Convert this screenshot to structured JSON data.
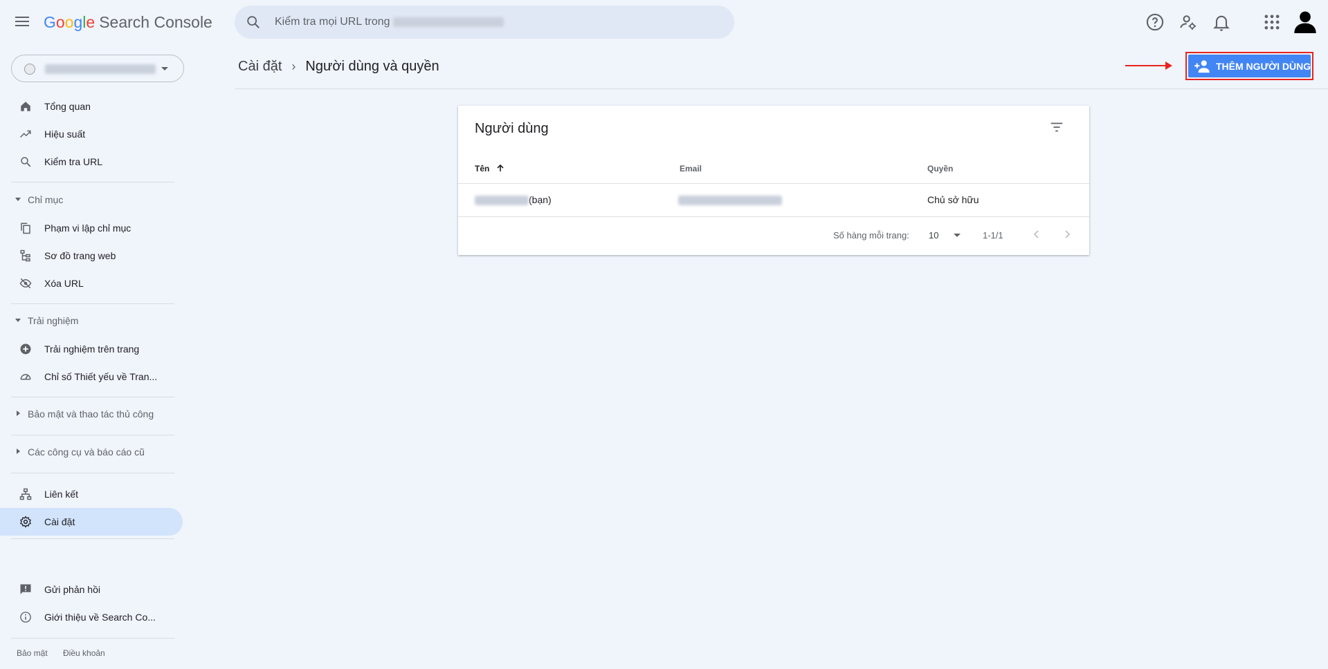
{
  "app": {
    "logo_letters": [
      "G",
      "o",
      "o",
      "g",
      "l",
      "e"
    ],
    "product": "Search Console"
  },
  "search": {
    "placeholder": "Kiểm tra mọi URL trong"
  },
  "top_icons": [
    "help-icon",
    "manage-account-icon",
    "notifications-icon",
    "apps-icon",
    "account-avatar"
  ],
  "sidebar": {
    "items": [
      {
        "label": "Tổng quan",
        "icon": "home-icon"
      },
      {
        "label": "Hiệu suất",
        "icon": "trending-up-icon"
      },
      {
        "label": "Kiểm tra URL",
        "icon": "search-icon"
      },
      {
        "label": "Phạm vi lập chỉ mục",
        "icon": "copy-icon"
      },
      {
        "label": "Sơ đồ trang web",
        "icon": "sitemap-icon"
      },
      {
        "label": "Xóa URL",
        "icon": "eye-off-icon"
      },
      {
        "label": "Trải nghiệm trên trang",
        "icon": "add-circle-icon"
      },
      {
        "label": "Chỉ số Thiết yếu về Tran...",
        "icon": "speed-icon"
      },
      {
        "label": "Liên kết",
        "icon": "links-icon"
      },
      {
        "label": "Cài đặt",
        "icon": "gear-icon"
      },
      {
        "label": "Gửi phản hồi",
        "icon": "feedback-icon"
      },
      {
        "label": "Giới thiệu về Search Co...",
        "icon": "info-icon"
      }
    ],
    "sections": [
      {
        "label": "Chỉ mục",
        "expanded": true
      },
      {
        "label": "Trải nghiệm",
        "expanded": true
      },
      {
        "label": "Bảo mật và thao tác thủ công",
        "expanded": false
      },
      {
        "label": "Các công cụ và báo cáo cũ",
        "expanded": false
      }
    ],
    "active_item": "Cài đặt",
    "footer": {
      "privacy": "Bảo mật",
      "terms": "Điều khoản"
    }
  },
  "header": {
    "breadcrumb_parent": "Cài đặt",
    "breadcrumb_current": "Người dùng và quyền",
    "add_user_label": "THÊM NGƯỜI DÙNG"
  },
  "users_card": {
    "title": "Người dùng",
    "columns": {
      "name": "Tên",
      "email": "Email",
      "permission": "Quyền"
    },
    "rows": [
      {
        "name_suffix": "(bạn)",
        "permission": "Chủ sở hữu"
      }
    ],
    "pagination": {
      "rows_per_page_label": "Số hàng mỗi trang:",
      "rows_per_page": "10",
      "range": "1-1/1"
    }
  },
  "colors": {
    "accent": "#4285f4",
    "highlight_box": "#e8231e",
    "active_nav": "#d2e3fc",
    "background": "#f0f4fb"
  }
}
